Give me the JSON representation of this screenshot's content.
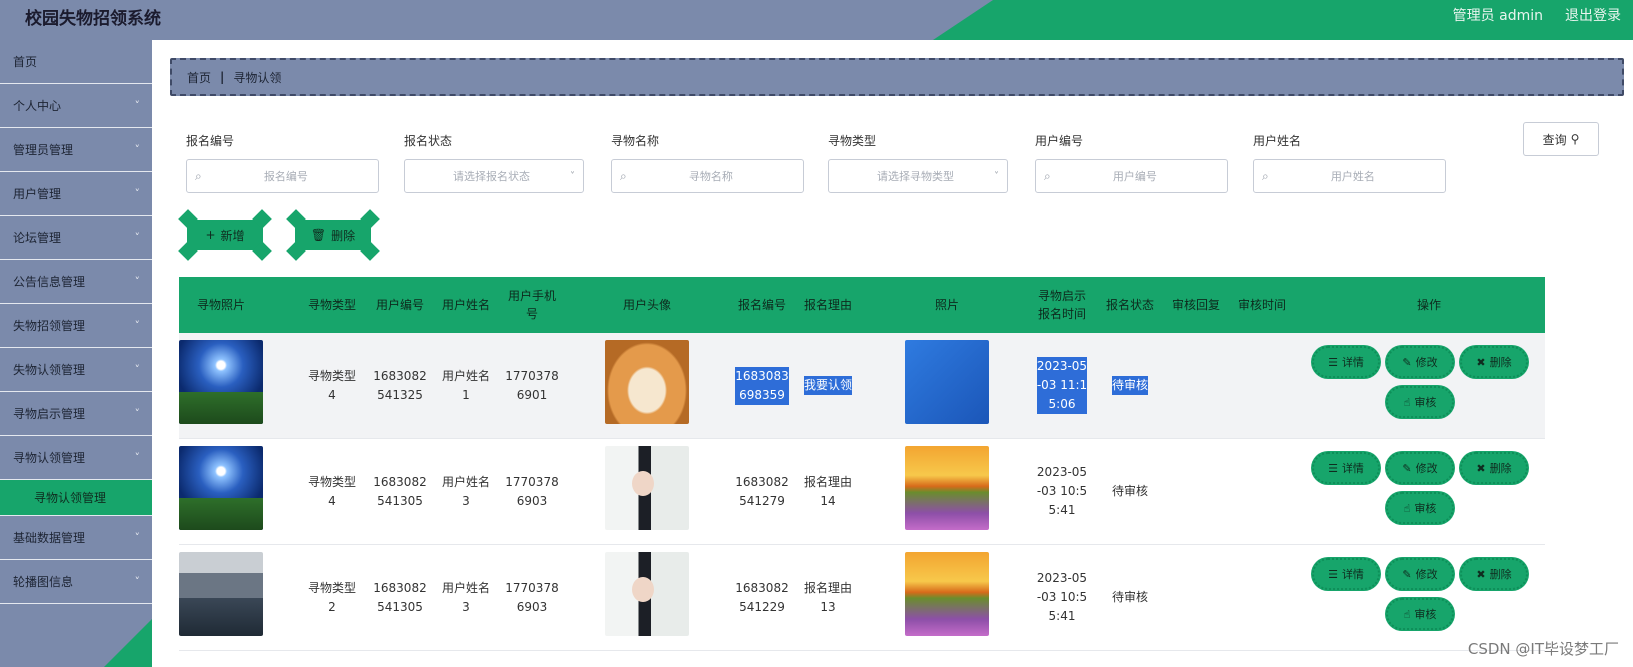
{
  "header": {
    "title": "校园失物招领系统",
    "admin_label": "管理员 admin",
    "logout_label": "退出登录"
  },
  "sidebar": {
    "items": [
      {
        "label": "首页",
        "has_arrow": false
      },
      {
        "label": "个人中心",
        "has_arrow": true
      },
      {
        "label": "管理员管理",
        "has_arrow": true
      },
      {
        "label": "用户管理",
        "has_arrow": true
      },
      {
        "label": "论坛管理",
        "has_arrow": true
      },
      {
        "label": "公告信息管理",
        "has_arrow": true
      },
      {
        "label": "失物招领管理",
        "has_arrow": true
      },
      {
        "label": "失物认领管理",
        "has_arrow": true
      },
      {
        "label": "寻物启示管理",
        "has_arrow": true
      },
      {
        "label": "寻物认领管理",
        "has_arrow": true
      },
      {
        "label": "寻物认领管理",
        "has_arrow": false,
        "active_sub": true
      },
      {
        "label": "基础数据管理",
        "has_arrow": true
      },
      {
        "label": "轮播图信息",
        "has_arrow": true
      }
    ]
  },
  "breadcrumb": {
    "home": "首页",
    "current": "寻物认领"
  },
  "filters": [
    {
      "label": "报名编号",
      "placeholder": "报名编号",
      "type": "input"
    },
    {
      "label": "报名状态",
      "placeholder": "请选择报名状态",
      "type": "select"
    },
    {
      "label": "寻物名称",
      "placeholder": "寻物名称",
      "type": "input"
    },
    {
      "label": "寻物类型",
      "placeholder": "请选择寻物类型",
      "type": "select"
    },
    {
      "label": "用户编号",
      "placeholder": "用户编号",
      "type": "input"
    },
    {
      "label": "用户姓名",
      "placeholder": "用户姓名",
      "type": "input"
    }
  ],
  "query_label": "查询",
  "add_label": "新增",
  "delete_label": "删除",
  "table": {
    "headers": [
      "寻物照片",
      "寻物类型",
      "用户编号",
      "用户姓名",
      "用户手机号",
      "用户头像",
      "报名编号",
      "报名理由",
      "照片",
      "寻物启示报名时间",
      "报名状态",
      "审核回复",
      "审核时间",
      "操作"
    ],
    "header_lines": {
      "phone": [
        "用户手机",
        "号"
      ],
      "time": [
        "寻物启示",
        "报名时间"
      ]
    },
    "rows": [
      {
        "type": [
          "寻物类型",
          "4"
        ],
        "user_no": [
          "1683082",
          "541325"
        ],
        "user_name": [
          "用户姓名",
          "1"
        ],
        "phone": [
          "1770378",
          "6901"
        ],
        "apply_no": [
          "1683083",
          "698359"
        ],
        "reason": [
          "我要认领"
        ],
        "time": [
          "2023-05",
          "-03 11:1",
          "5:06"
        ],
        "status": "待审核",
        "photo": "night",
        "avatar": "dog",
        "img": "blue"
      },
      {
        "type": [
          "寻物类型",
          "4"
        ],
        "user_no": [
          "1683082",
          "541305"
        ],
        "user_name": [
          "用户姓名",
          "3"
        ],
        "phone": [
          "1770378",
          "6903"
        ],
        "apply_no": [
          "1683082",
          "541279"
        ],
        "reason": [
          "报名理由",
          "14"
        ],
        "time": [
          "2023-05",
          "-03 10:5",
          "5:41"
        ],
        "status": "待审核",
        "photo": "night",
        "avatar": "lady",
        "img": "sunset"
      },
      {
        "type": [
          "寻物类型",
          "2"
        ],
        "user_no": [
          "1683082",
          "541305"
        ],
        "user_name": [
          "用户姓名",
          "3"
        ],
        "phone": [
          "1770378",
          "6903"
        ],
        "apply_no": [
          "1683082",
          "541229"
        ],
        "reason": [
          "报名理由",
          "13"
        ],
        "time": [
          "2023-05",
          "-03 10:5",
          "5:41"
        ],
        "status": "待审核",
        "photo": "lake",
        "avatar": "lady",
        "img": "sunset"
      }
    ],
    "ops": {
      "detail": "详情",
      "edit": "修改",
      "delete": "删除",
      "audit": "审核"
    }
  },
  "watermark": "CSDN @IT毕设梦工厂",
  "colors": {
    "accent": "#17a56b",
    "sidebar": "#7b8aab",
    "selection": "#2e6dd8"
  }
}
